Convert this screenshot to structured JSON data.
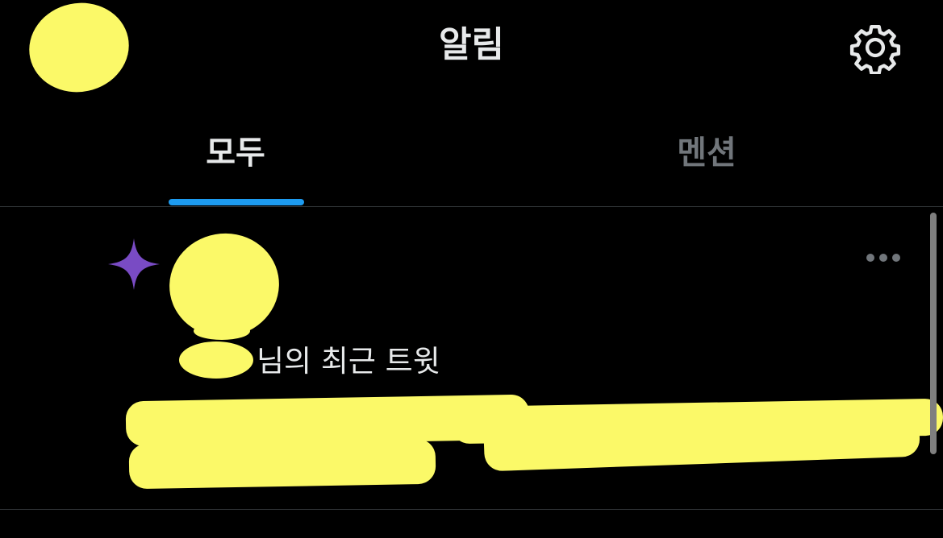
{
  "header": {
    "title": "알림",
    "settings_icon": "gear-icon"
  },
  "tabs": [
    {
      "label": "모두",
      "active": true
    },
    {
      "label": "멘션",
      "active": false
    }
  ],
  "notification": {
    "icon": "sparkle-icon",
    "text": "님의 최근 트윗",
    "more_icon": "more-horizontal-icon"
  },
  "colors": {
    "background": "#000000",
    "text_primary": "#e7e9ea",
    "text_secondary": "#71767b",
    "accent": "#1d9bf0",
    "sparkle": "#794bc4",
    "divider": "#2f3336",
    "redaction": "#fbf968"
  }
}
